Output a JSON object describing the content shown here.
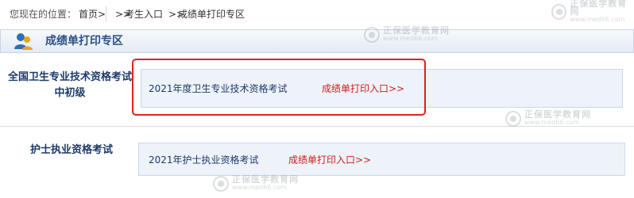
{
  "breadcrumb": {
    "label": "您现在的位置：",
    "home": "首页>",
    "sep1": ">>",
    "entry": "考生入口",
    "sep2": ">>",
    "current": "成绩单打印专区"
  },
  "section": {
    "title": "成绩单打印专区",
    "icon": "person-icon"
  },
  "categories": [
    {
      "label": "全国卫生专业技术资格考试中初级",
      "exam": "2021年度卫生专业技术资格考试",
      "link": "成绩单打印入口>>"
    },
    {
      "label": "护士执业资格考试",
      "exam": "2021年护士执业资格考试",
      "link": "成绩单打印入口>>"
    }
  ],
  "watermark": {
    "brand": "正保医学教育网",
    "url": "www.med66.com"
  },
  "colors": {
    "title": "#2b4f86",
    "link": "#cc1f1f",
    "highlight": "#e02020",
    "box_bg": "#eef3f9"
  }
}
